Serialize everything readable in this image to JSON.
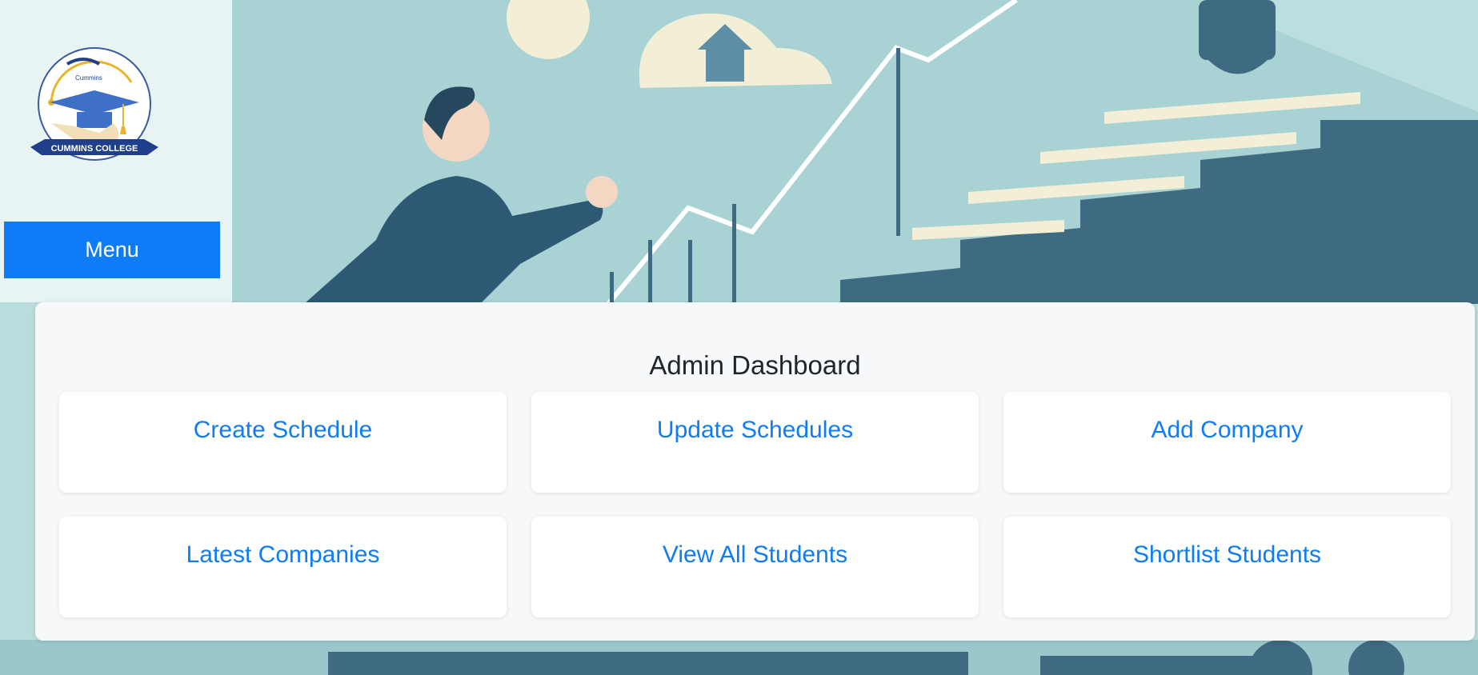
{
  "sidebar": {
    "logo_text": "CUMMINS COLLEGE",
    "logo_small": "Cummins",
    "menu_label": "Menu"
  },
  "dashboard": {
    "title": "Admin Dashboard",
    "cards": [
      {
        "label": "Create Schedule"
      },
      {
        "label": "Update Schedules"
      },
      {
        "label": "Add Company"
      },
      {
        "label": "Latest Companies"
      },
      {
        "label": "View All Students"
      },
      {
        "label": "Shortlist Students"
      }
    ]
  },
  "colors": {
    "accent": "#0d7cf6",
    "panel_bg": "#f6f8f9",
    "illustration_dark": "#3e6a82",
    "illustration_light": "#b9dcdc"
  }
}
